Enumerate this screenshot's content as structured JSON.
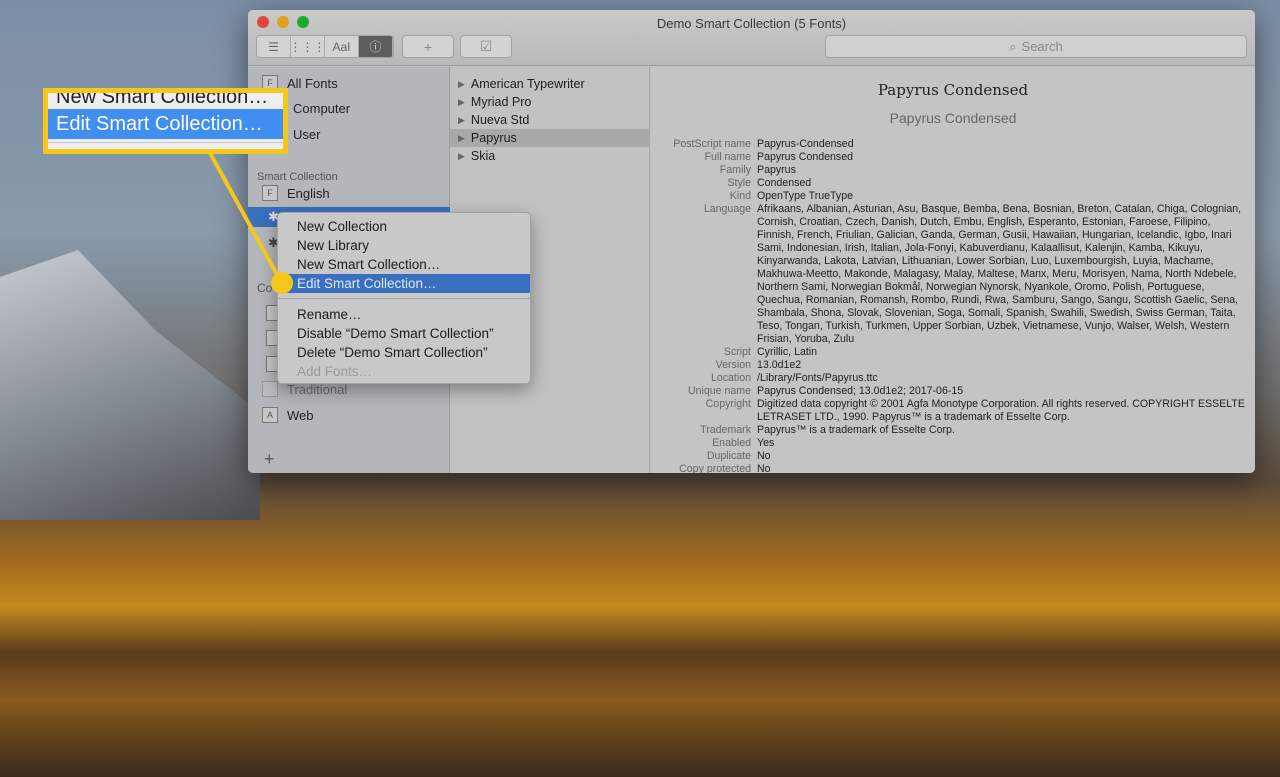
{
  "window": {
    "title": "Demo Smart Collection (5 Fonts)"
  },
  "toolbar": {
    "view_buttons": [
      "list-icon",
      "grid-icon",
      "sample-icon",
      "info-icon"
    ],
    "sample_label": "AaI",
    "add_label": "+",
    "search_placeholder": "Search"
  },
  "sidebar": {
    "items_top": [
      {
        "label": "All Fonts"
      },
      {
        "label": "Computer"
      },
      {
        "label": "User"
      }
    ],
    "smart_header": "Smart Collection",
    "smart_items": [
      {
        "label": "English"
      }
    ],
    "collection_header_partial": "Co",
    "collection_items": [
      {
        "label": "Traditional"
      },
      {
        "label": "Web"
      }
    ],
    "add_label": "+"
  },
  "font_list": [
    {
      "label": "American Typewriter"
    },
    {
      "label": "Myriad Pro"
    },
    {
      "label": "Nueva Std"
    },
    {
      "label": "Papyrus",
      "selected": true
    },
    {
      "label": "Skia"
    }
  ],
  "info": {
    "title": "Papyrus Condensed",
    "subtitle": "Papyrus Condensed",
    "rows": [
      {
        "k": "PostScript name",
        "v": "Papyrus-Condensed"
      },
      {
        "k": "Full name",
        "v": "Papyrus Condensed"
      },
      {
        "k": "Family",
        "v": "Papyrus"
      },
      {
        "k": "Style",
        "v": "Condensed"
      },
      {
        "k": "Kind",
        "v": "OpenType TrueType"
      },
      {
        "k": "Language",
        "v": "Afrikaans, Albanian, Asturian, Asu, Basque, Bemba, Bena, Bosnian, Breton, Catalan, Chiga, Colognian, Cornish, Croatian, Czech, Danish, Dutch, Embu, English, Esperanto, Estonian, Faroese, Filipino, Finnish, French, Friulian, Galician, Ganda, German, Gusii, Hawaiian, Hungarian, Icelandic, Igbo, Inari Sami, Indonesian, Irish, Italian, Jola-Fonyi, Kabuverdianu, Kalaallisut, Kalenjin, Kamba, Kikuyu, Kinyarwanda, Lakota, Latvian, Lithuanian, Lower Sorbian, Luo, Luxembourgish, Luyia, Machame, Makhuwa-Meetto, Makonde, Malagasy, Malay, Maltese, Manx, Meru, Morisyen, Nama, North Ndebele, Northern Sami, Norwegian Bokmål, Norwegian Nynorsk, Nyankole, Oromo, Polish, Portuguese, Quechua, Romanian, Romansh, Rombo, Rundi, Rwa, Samburu, Sango, Sangu, Scottish Gaelic, Sena, Shambala, Shona, Slovak, Slovenian, Soga, Somali, Spanish, Swahili, Swedish, Swiss German, Taita, Teso, Tongan, Turkish, Turkmen, Upper Sorbian, Uzbek, Vietnamese, Vunjo, Walser, Welsh, Western Frisian, Yoruba, Zulu"
      },
      {
        "k": "Script",
        "v": "Cyrillic, Latin"
      },
      {
        "k": "Version",
        "v": "13.0d1e2"
      },
      {
        "k": "Location",
        "v": "/Library/Fonts/Papyrus.ttc"
      },
      {
        "k": "Unique name",
        "v": "Papyrus Condensed; 13.0d1e2; 2017-06-15"
      },
      {
        "k": "Copyright",
        "v": "Digitized data copyright © 2001 Agfa Monotype Corporation. All rights reserved. COPYRIGHT ESSELTE LETRASET LTD., 1990. Papyrus™ is a trademark of Esselte Corp."
      },
      {
        "k": "Trademark",
        "v": "Papyrus™ is a trademark of Esselte Corp."
      },
      {
        "k": "Enabled",
        "v": "Yes"
      },
      {
        "k": "Duplicate",
        "v": "No"
      },
      {
        "k": "Copy protected",
        "v": "No"
      }
    ]
  },
  "context_menu": {
    "group1": [
      {
        "label": "New Collection"
      },
      {
        "label": "New Library"
      },
      {
        "label": "New Smart Collection…"
      },
      {
        "label": "Edit Smart Collection…",
        "highlighted": true
      }
    ],
    "group2": [
      {
        "label": "Rename…"
      },
      {
        "label": "Disable “Demo Smart Collection”"
      },
      {
        "label": "Delete “Demo Smart Collection”"
      },
      {
        "label": "Add Fonts…",
        "disabled": true
      }
    ]
  },
  "callout": {
    "above": "New Smart Collection…",
    "focus": "Edit Smart Collection…"
  },
  "colors": {
    "callout": "#f4c71c",
    "highlight": "#3a6fbf",
    "close": "#e0443e",
    "minimize": "#dea123",
    "zoom": "#1aab29"
  }
}
